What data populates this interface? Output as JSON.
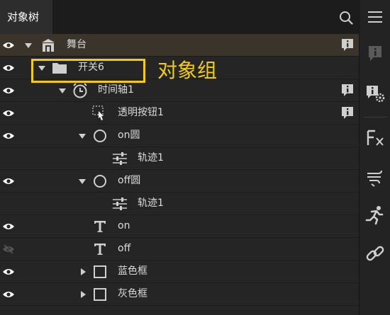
{
  "header": {
    "tab_label": "对象树",
    "search_icon": "search-icon",
    "menu_icon": "hamburger-menu-icon"
  },
  "sidebar": {
    "icons": [
      "info-bubble-icon",
      "info-gear-icon",
      "fx-icon",
      "wind-icon",
      "running-icon",
      "link-icon"
    ]
  },
  "tree": {
    "rows": [
      {
        "label": "舞台",
        "icon": "stage-icon",
        "visible": true,
        "expanded": true
      },
      {
        "label": "开关6",
        "icon": "folder-icon",
        "visible": true,
        "expanded": true
      },
      {
        "label": "时间轴1",
        "icon": "timeline-icon",
        "visible": true,
        "expanded": true
      },
      {
        "label": "透明按钮1",
        "icon": "transparent-button-icon",
        "visible": true
      },
      {
        "label": "on圆",
        "icon": "circle-icon",
        "visible": true,
        "expanded": true
      },
      {
        "label": "轨迹1",
        "icon": "track-icon",
        "visible": null
      },
      {
        "label": "off圆",
        "icon": "circle-icon",
        "visible": true,
        "expanded": true
      },
      {
        "label": "轨迹1",
        "icon": "track-icon",
        "visible": null
      },
      {
        "label": "on",
        "icon": "text-icon",
        "visible": true
      },
      {
        "label": "off",
        "icon": "text-icon",
        "visible": false
      },
      {
        "label": "蓝色框",
        "icon": "square-icon",
        "visible": true,
        "expanded": false
      },
      {
        "label": "灰色框",
        "icon": "square-icon",
        "visible": true,
        "expanded": false
      }
    ]
  },
  "annotation": {
    "text": "对象组",
    "color": "#f3cf00"
  },
  "colors": {
    "accent": "#f3cf00",
    "stage_row": "#3a342a",
    "background": "#252526"
  }
}
